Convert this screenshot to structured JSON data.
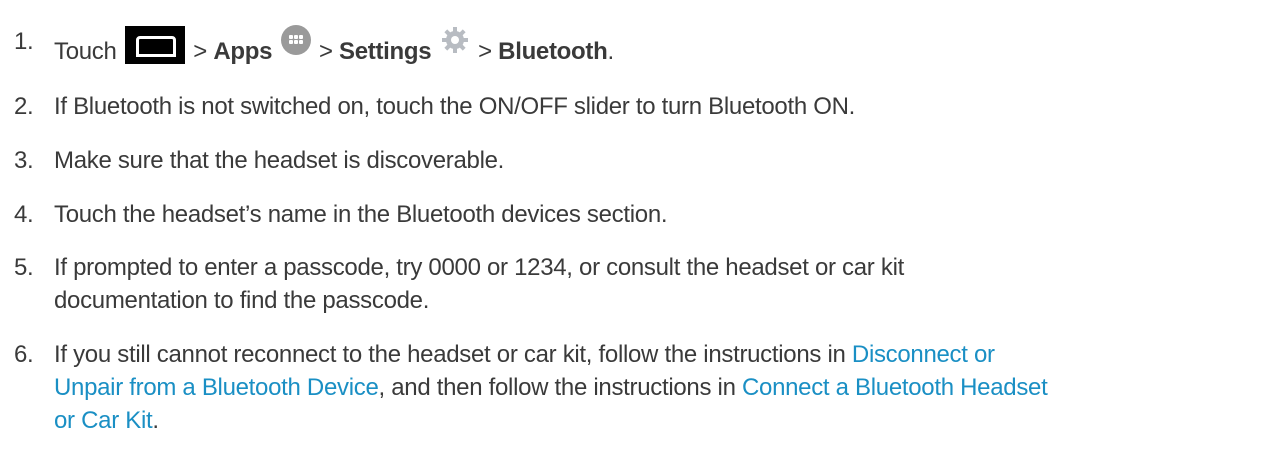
{
  "steps": [
    {
      "number": "1.",
      "parts": {
        "touch": "Touch",
        "sep1": ">",
        "apps": "Apps",
        "sep2": ">",
        "settings": "Settings",
        "sep3": ">",
        "bluetooth": "Bluetooth",
        "end": "."
      },
      "icons": [
        "home-icon",
        "apps-icon",
        "settings-gear-icon"
      ]
    },
    {
      "number": "2.",
      "text": "If Bluetooth is not switched on, touch the ON/OFF slider to turn Bluetooth ON."
    },
    {
      "number": "3.",
      "text": "Make sure that the headset is discoverable."
    },
    {
      "number": "4.",
      "text": "Touch the headset’s name in the Bluetooth devices section."
    },
    {
      "number": "5.",
      "line1": "If prompted to enter a passcode, try 0000 or 1234, or consult the headset or car kit",
      "line2": "documentation to find the passcode."
    },
    {
      "number": "6.",
      "text_before_link1": "If you still cannot reconnect to the headset or car kit, follow the instructions in ",
      "link1_part1": "Disconnect or",
      "link1_part2": "Unpair from a Bluetooth Device",
      "text_between_links": ", and then follow the instructions in ",
      "link2_part1": "Connect a Bluetooth Headset",
      "link2_part2": "or Car Kit",
      "text_end": "."
    }
  ],
  "colors": {
    "text": "#3a3a3a",
    "link": "#1a8fc4"
  }
}
